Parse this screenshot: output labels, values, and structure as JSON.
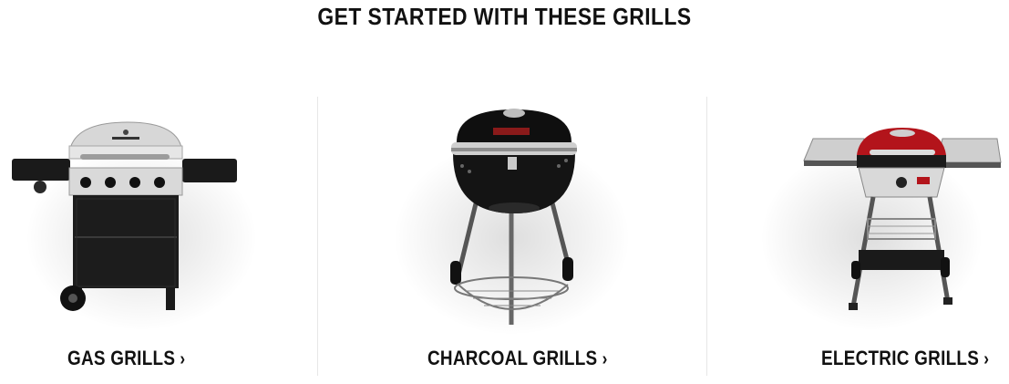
{
  "section": {
    "title": "GET STARTED WITH THESE GRILLS"
  },
  "cards": [
    {
      "label": "GAS GRILLS",
      "chevron": "›",
      "image_icon": "gas-grill"
    },
    {
      "label": "CHARCOAL GRILLS",
      "chevron": "›",
      "image_icon": "charcoal-grill"
    },
    {
      "label": "ELECTRIC GRILLS",
      "chevron": "›",
      "image_icon": "electric-grill"
    }
  ],
  "colors": {
    "text": "#111111",
    "divider": "#e7e7e7",
    "grill_black": "#1a1a1a",
    "electric_red": "#b3141b",
    "steel": "#c9c9c9"
  }
}
